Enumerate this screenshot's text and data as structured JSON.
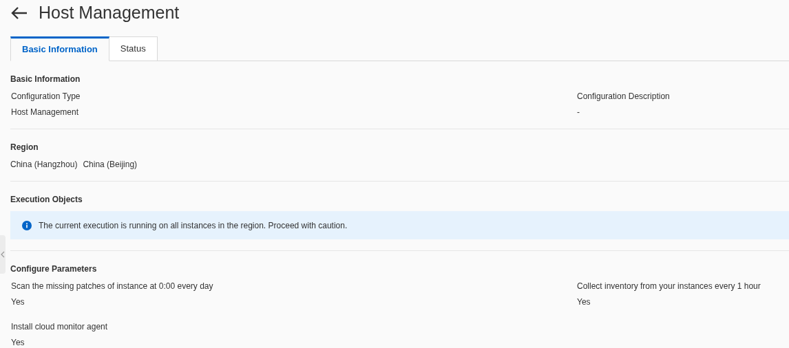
{
  "header": {
    "title": "Host Management"
  },
  "tabs": [
    {
      "label": "Basic Information",
      "selected": true
    },
    {
      "label": "Status",
      "selected": false
    }
  ],
  "sections": [
    {
      "kind": "fields",
      "title": "Basic Information",
      "fields": [
        {
          "label": "Configuration Type",
          "values": [
            "Host Management"
          ]
        },
        {
          "label": "Configuration Description",
          "values": [
            "-"
          ]
        }
      ]
    },
    {
      "kind": "fields",
      "title": "Region",
      "values": [
        "China (Hangzhou)",
        "China (Beijing)"
      ]
    },
    {
      "kind": "alert",
      "title": "Execution Objects",
      "message": "The current execution is running on all instances in the region. Proceed with caution."
    },
    {
      "kind": "fields",
      "title": "Configure Parameters",
      "fields": [
        {
          "label": "Scan the missing patches of instance at 0:00 every day",
          "values": [
            "Yes"
          ]
        },
        {
          "label": "Collect inventory from your instances every 1 hour",
          "values": [
            "Yes"
          ]
        },
        {
          "label": "Install cloud monitor agent",
          "values": [
            "Yes"
          ]
        }
      ]
    }
  ]
}
